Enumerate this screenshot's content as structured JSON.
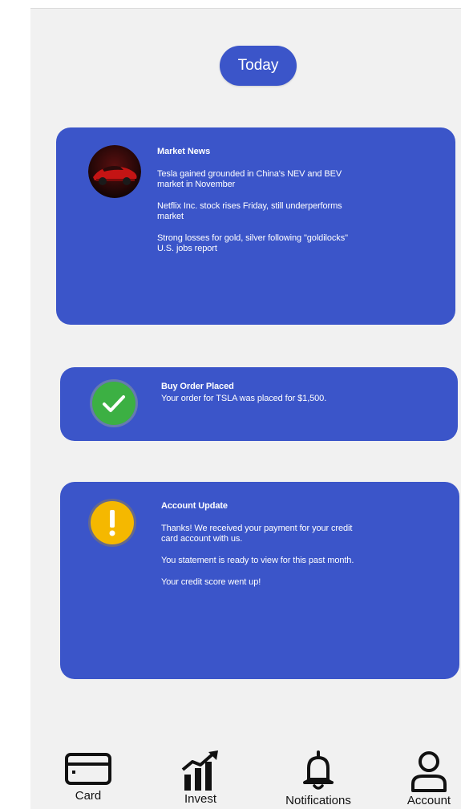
{
  "header": {
    "date_pill": "Today"
  },
  "cards": {
    "market_news": {
      "title": "Market News",
      "items": [
        "Tesla gained grounded in China's NEV and BEV market in November",
        "Netflix Inc. stock rises Friday, still underperforms market",
        "Strong losses for gold, silver following \"goldilocks\" U.S. jobs report"
      ]
    },
    "buy_order": {
      "title": "Buy Order Placed",
      "body": "Your order for TSLA was placed for $1,500.",
      "status_icon": "checkmark-icon",
      "status_color": "#3cb043"
    },
    "account_update": {
      "title": "Account Update",
      "items": [
        "Thanks! We received your payment for your credit card account with us.",
        "You statement is ready to view for this past month.",
        "Your credit score went up!"
      ],
      "status_icon": "exclamation-icon",
      "status_color": "#f5b800"
    }
  },
  "tabbar": {
    "items": [
      {
        "label": "Card",
        "icon": "credit-card-icon"
      },
      {
        "label": "Invest",
        "icon": "growth-chart-icon"
      },
      {
        "label": "Notifications",
        "icon": "bell-icon"
      },
      {
        "label": "Account",
        "icon": "user-icon"
      }
    ]
  },
  "colors": {
    "accent": "#3b55c9",
    "background": "#f1f1f1",
    "text_on_accent": "#ffffff"
  }
}
